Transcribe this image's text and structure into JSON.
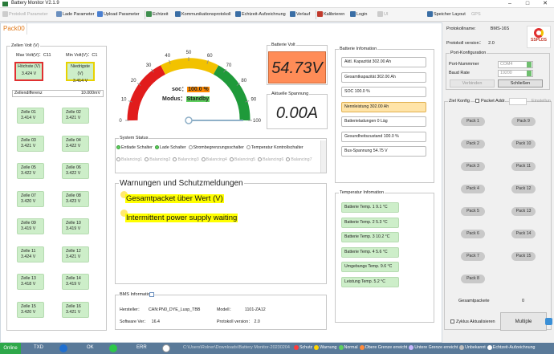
{
  "window": {
    "title": "Battery Monitor V2.1.9"
  },
  "toolbar": {
    "items": [
      {
        "label": "Protokoll Parameter",
        "disabled": true
      },
      {
        "label": "Lade Parameter",
        "disabled": false
      },
      {
        "label": "Upload Parameter",
        "disabled": false
      },
      {
        "label": "Echtzeit",
        "disabled": false
      },
      {
        "label": "Kommunikationsprotokoll",
        "disabled": false
      },
      {
        "label": "Echtzeit-Aufzeichnung",
        "disabled": false
      },
      {
        "label": "Verlauf",
        "disabled": false
      },
      {
        "label": "Kalibrieren",
        "disabled": false
      },
      {
        "label": "Login",
        "disabled": false
      },
      {
        "label": "UI",
        "disabled": true
      },
      {
        "label": "Speicher Layout",
        "disabled": false
      },
      {
        "label": "GPS",
        "disabled": true
      }
    ]
  },
  "tab": {
    "label": "Pack00"
  },
  "cells_group": {
    "title": "Zellen Volt (V)",
    "max_label": "Max Volt(V)：C11",
    "min_label": "Min Volt(V)：C1",
    "max_name": "Höchste (V)",
    "max_value": "3.424 V",
    "min_name": "Niedrigste (V)",
    "min_value": "3.414 V",
    "diff_label": "Zellendifferenz",
    "diff_value": "10.000mV",
    "cells": [
      {
        "name": "Zelle 01",
        "value": "3.414 V"
      },
      {
        "name": "Zelle 02",
        "value": "3.421 V"
      },
      {
        "name": "Zelle 03",
        "value": "3.421 V"
      },
      {
        "name": "Zelle 04",
        "value": "3.422 V"
      },
      {
        "name": "Zelle 05",
        "value": "3.422 V"
      },
      {
        "name": "Zelle 06",
        "value": "3.422 V"
      },
      {
        "name": "Zelle 07",
        "value": "3.420 V"
      },
      {
        "name": "Zelle 08",
        "value": "3.423 V"
      },
      {
        "name": "Zelle 09",
        "value": "3.419 V"
      },
      {
        "name": "Zelle 10",
        "value": "3.419 V"
      },
      {
        "name": "Zelle 11",
        "value": "3.424 V"
      },
      {
        "name": "Zelle 12",
        "value": "3.421 V"
      },
      {
        "name": "Zelle 13",
        "value": "3.418 V"
      },
      {
        "name": "Zelle 14",
        "value": "3.419 V"
      },
      {
        "name": "Zelle 15",
        "value": "3.420 V"
      },
      {
        "name": "Zelle 16",
        "value": "3.421 V"
      }
    ]
  },
  "gauge": {
    "ticks": [
      "0",
      "10",
      "20",
      "30",
      "40",
      "50",
      "60",
      "70",
      "80",
      "90",
      "100"
    ],
    "soc_label": "soc：",
    "soc_value": "100.0 %",
    "modus_label": "Modus：",
    "modus_value": "Standby",
    "value_percent": 100
  },
  "voltage": {
    "title": "Batterie Volt",
    "value": "54.73V"
  },
  "current": {
    "title": "Aktuelle Spannung",
    "value": "0.00A"
  },
  "battery_info": {
    "title": "Batterie Infomation",
    "rows": [
      "Aktl. Kapazität   302.00 Ah",
      "Gesamtkapazität   302.00 Ah",
      "SOC              100.0 %",
      "Nennleistung    302.00 Ah",
      "Batterieladungen   0 Läg",
      "Gesundheitszustand   100.0 %",
      "Bus-Spannung       54.75 V"
    ],
    "highlight_index": 3
  },
  "system_status": {
    "title": "System Status",
    "row1": [
      {
        "label": "Entlade Schalter",
        "on": true
      },
      {
        "label": "Lade Schalter",
        "on": true
      },
      {
        "label": "Strombegrenzungsschalter",
        "on": false
      },
      {
        "label": "Temperatur Kontrollschalter",
        "on": false
      }
    ],
    "row2": [
      {
        "label": "Balancing1",
        "on": false
      },
      {
        "label": "Balancing2",
        "on": false
      },
      {
        "label": "Balancing3",
        "on": false
      },
      {
        "label": "Balancing4",
        "on": false
      },
      {
        "label": "Balancing5",
        "on": false
      },
      {
        "label": "Balancing6",
        "on": false
      },
      {
        "label": "Balancing7",
        "on": false
      }
    ]
  },
  "warnings": {
    "title": "Warnungen und Schutzmeldungen",
    "items": [
      "Gesamtpacket über Wert (V)",
      "Intermittent power supply waiting"
    ]
  },
  "temperature": {
    "title": "Temperatur Infomation",
    "rows": [
      "Batterie Temp. 1     9.1 °C",
      "Batterie Temp. 2     5.3 °C",
      "Batterie Temp. 3    10.2 °C",
      "Batterie Temp. 4     5.6 °C",
      "Umgebungs Temp.    9.6 °C",
      "Leistung Temp.      5.2 °C"
    ]
  },
  "bms_info": {
    "title": "BMS Information",
    "hersteller_label": "Hersteller：",
    "hersteller_value": "CAN:PN0_DYE_Lusp_TBB",
    "modell_label": "Modell：",
    "modell_value": "1101-ZA12",
    "software_label": "Software Ver：",
    "software_value": "16.4",
    "protokoll_label": "Protokoll version：",
    "protokoll_value": "2.0"
  },
  "side": {
    "protokoll_name_label": "Protokollname:",
    "protokoll_name_value": "BMS-16S",
    "protokoll_version_label": "Protokoll version：",
    "protokoll_version_value": "2.0",
    "brand": "SSPLDS",
    "port_title": "Port-Konfiguration",
    "port_label": "Port-Nummmer",
    "port_value": "COM4",
    "baud_label": "Baud Rate",
    "baud_value": "19200",
    "connect_btn": "Verbinden",
    "close_btn": "Schließen",
    "ziel_label": "Ziel Konfig",
    "packet_label": "Packet Addr.",
    "einst_label": "Einstellun",
    "packs": [
      "Pack 1",
      "Pack 9",
      "Pack 2",
      "Pack 10",
      "Pack 3",
      "Pack 11",
      "Pack 4",
      "Pack 12",
      "Pack 5",
      "Pack 13",
      "Pack 6",
      "Pack 14",
      "Pack 7",
      "Pack 15",
      "Pack 8"
    ],
    "gesamt_label": "Gesamtpackete",
    "gesamt_value": "0",
    "zyklus_label": "Zyklus Aktualisieren",
    "multiple_btn": "Multiple"
  },
  "statusbar": {
    "online": "Online",
    "txd": "TXD",
    "ok": "OK",
    "err": "ERR",
    "path": "C:\\Users\\Rolner\\Downloads\\Battery Monitor-20230204",
    "legend": [
      {
        "label": "Schutz",
        "color": "#ff3b3b"
      },
      {
        "label": "Warnung",
        "color": "#ffd400"
      },
      {
        "label": "Normal",
        "color": "#5fcf5f"
      },
      {
        "label": "Obere Grenze erreicht",
        "color": "#ff8a3d"
      },
      {
        "label": "Untere Grenze erreicht",
        "color": "#c9b8ff"
      },
      {
        "label": "Unbekannt",
        "color": "#bdbdbd"
      },
      {
        "label": "Echtzeit-Aufzeichnung",
        "color": "#ffffff"
      }
    ]
  }
}
